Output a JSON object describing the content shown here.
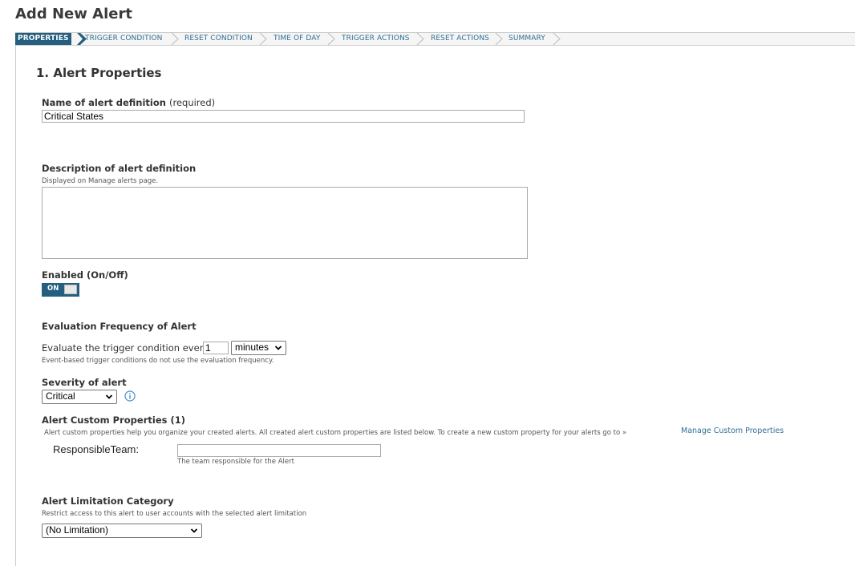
{
  "page": {
    "title": "Add New Alert"
  },
  "wizard": {
    "steps": [
      {
        "label": "PROPERTIES",
        "active": true
      },
      {
        "label": "TRIGGER CONDITION"
      },
      {
        "label": "RESET CONDITION"
      },
      {
        "label": "TIME OF DAY"
      },
      {
        "label": "TRIGGER ACTIONS"
      },
      {
        "label": "RESET ACTIONS"
      },
      {
        "label": "SUMMARY"
      }
    ]
  },
  "section": {
    "title": "1. Alert Properties"
  },
  "name_field": {
    "label": "Name of alert definition",
    "required": "(required)",
    "value": "Critical States"
  },
  "description": {
    "label": "Description of alert definition",
    "hint": "Displayed on Manage alerts page.",
    "value": ""
  },
  "enabled": {
    "label": "Enabled (On/Off)",
    "state": "ON"
  },
  "frequency": {
    "label": "Evaluation Frequency of Alert",
    "prefix": "Evaluate the trigger condition every",
    "value": "1",
    "unit": "minutes",
    "hint": "Event-based trigger conditions do not use the evaluation frequency."
  },
  "severity": {
    "label": "Severity of alert",
    "value": "Critical"
  },
  "custom_props": {
    "label": "Alert Custom Properties (1)",
    "hint": "Alert custom properties help you organize your created alerts. All created alert custom properties are listed below. To create a new custom property for your alerts go to »",
    "link": "Manage Custom Properties",
    "prop_name": "ResponsibleTeam:",
    "prop_value": "",
    "prop_hint": "The team responsible for the Alert"
  },
  "limitation": {
    "label": "Alert Limitation Category",
    "hint": "Restrict access to this alert to user accounts with the selected alert limitation",
    "value": "(No Limitation)"
  },
  "colors": {
    "accent": "#255f80",
    "link": "#2f6f95"
  }
}
